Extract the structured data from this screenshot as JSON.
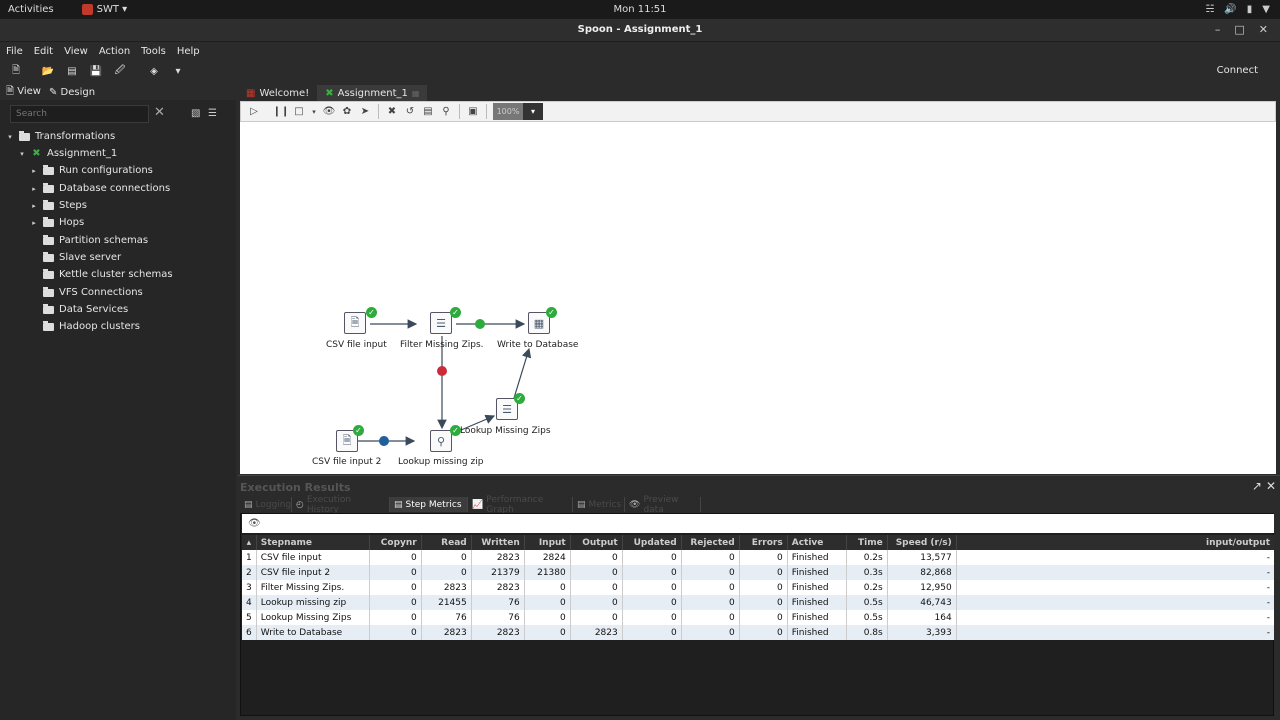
{
  "topbar": {
    "activities": "Activities",
    "app_name": "SWT ▾",
    "clock": "Mon 11:51"
  },
  "window": {
    "title": "Spoon - Assignment_1"
  },
  "menu": [
    "File",
    "Edit",
    "View",
    "Action",
    "Tools",
    "Help"
  ],
  "toolbar": {
    "connect": "Connect"
  },
  "left_panel": {
    "tab_view": "View",
    "tab_design": "Design",
    "search_placeholder": "Search",
    "tree": [
      {
        "label": "Transformations",
        "level": 0,
        "arrow": "▾",
        "icon": "folder"
      },
      {
        "label": "Assignment_1",
        "level": 1,
        "arrow": "▾",
        "icon": "transformation"
      },
      {
        "label": "Run configurations",
        "level": 2,
        "arrow": "▸",
        "icon": "folder"
      },
      {
        "label": "Database connections",
        "level": 2,
        "arrow": "▸",
        "icon": "folder"
      },
      {
        "label": "Steps",
        "level": 2,
        "arrow": "▸",
        "icon": "folder"
      },
      {
        "label": "Hops",
        "level": 2,
        "arrow": "▸",
        "icon": "folder"
      },
      {
        "label": "Partition schemas",
        "level": 2,
        "arrow": "",
        "icon": "folder"
      },
      {
        "label": "Slave server",
        "level": 2,
        "arrow": "",
        "icon": "folder"
      },
      {
        "label": "Kettle cluster schemas",
        "level": 2,
        "arrow": "",
        "icon": "folder"
      },
      {
        "label": "VFS Connections",
        "level": 2,
        "arrow": "",
        "icon": "folder"
      },
      {
        "label": "Data Services",
        "level": 2,
        "arrow": "",
        "icon": "folder"
      },
      {
        "label": "Hadoop clusters",
        "level": 2,
        "arrow": "",
        "icon": "folder"
      }
    ]
  },
  "doc_tabs": {
    "welcome": "Welcome!",
    "assignment": "Assignment_1"
  },
  "canvas_toolbar": {
    "zoom": "100%"
  },
  "steps": {
    "csv_input": "CSV file input",
    "filter": "Filter Missing Zips.",
    "write_db": "Write to Database",
    "csv_input2": "CSV file input 2",
    "lookup_zip": "Lookup missing zip",
    "lookup_zips": "Lookup Missing Zips"
  },
  "execution": {
    "title": "Execution Results",
    "tabs": {
      "logging": "Logging",
      "history": "Execution History",
      "metrics": "Step Metrics",
      "perf": "Performance Graph",
      "metrics2": "Metrics",
      "preview": "Preview data"
    },
    "columns": [
      "Stepname",
      "Copynr",
      "Read",
      "Written",
      "Input",
      "Output",
      "Updated",
      "Rejected",
      "Errors",
      "Active",
      "Time",
      "Speed (r/s)",
      "input/output"
    ],
    "rows": [
      {
        "num": "1",
        "stepname": "CSV file input",
        "copynr": "0",
        "read": "0",
        "written": "2823",
        "input": "2824",
        "output": "0",
        "updated": "0",
        "rejected": "0",
        "errors": "0",
        "active": "Finished",
        "time": "0.2s",
        "speed": "13,577",
        "io": "-"
      },
      {
        "num": "2",
        "stepname": "CSV file input 2",
        "copynr": "0",
        "read": "0",
        "written": "21379",
        "input": "21380",
        "output": "0",
        "updated": "0",
        "rejected": "0",
        "errors": "0",
        "active": "Finished",
        "time": "0.3s",
        "speed": "82,868",
        "io": "-"
      },
      {
        "num": "3",
        "stepname": "Filter Missing Zips.",
        "copynr": "0",
        "read": "2823",
        "written": "2823",
        "input": "0",
        "output": "0",
        "updated": "0",
        "rejected": "0",
        "errors": "0",
        "active": "Finished",
        "time": "0.2s",
        "speed": "12,950",
        "io": "-"
      },
      {
        "num": "4",
        "stepname": "Lookup missing zip",
        "copynr": "0",
        "read": "21455",
        "written": "76",
        "input": "0",
        "output": "0",
        "updated": "0",
        "rejected": "0",
        "errors": "0",
        "active": "Finished",
        "time": "0.5s",
        "speed": "46,743",
        "io": "-"
      },
      {
        "num": "5",
        "stepname": "Lookup Missing Zips",
        "copynr": "0",
        "read": "76",
        "written": "76",
        "input": "0",
        "output": "0",
        "updated": "0",
        "rejected": "0",
        "errors": "0",
        "active": "Finished",
        "time": "0.5s",
        "speed": "164",
        "io": "-"
      },
      {
        "num": "6",
        "stepname": "Write to Database",
        "copynr": "0",
        "read": "2823",
        "written": "2823",
        "input": "0",
        "output": "2823",
        "updated": "0",
        "rejected": "0",
        "errors": "0",
        "active": "Finished",
        "time": "0.8s",
        "speed": "3,393",
        "io": "-"
      }
    ]
  },
  "colors": {
    "success": "#2eab3d",
    "error": "#cc2b3a",
    "info": "#1f5f9a"
  }
}
